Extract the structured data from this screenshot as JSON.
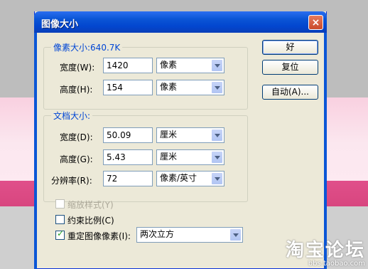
{
  "dialog": {
    "title": "图像大小",
    "close_glyph": "×"
  },
  "pixel_dimensions": {
    "legend": "像素大小:640.7K",
    "width": {
      "label": "宽度(W):",
      "value": "1420",
      "unit": "像素"
    },
    "height": {
      "label": "高度(H):",
      "value": "154",
      "unit": "像素"
    }
  },
  "document_size": {
    "legend": "文档大小:",
    "width": {
      "label": "宽度(D):",
      "value": "50.09",
      "unit": "厘米"
    },
    "height": {
      "label": "高度(G):",
      "value": "5.43",
      "unit": "厘米"
    },
    "resolution": {
      "label": "分辨率(R):",
      "value": "72",
      "unit": "像素/英寸"
    }
  },
  "options": {
    "scale_styles": {
      "label": "缩放样式(Y)",
      "checked": false,
      "enabled": false
    },
    "constrain_proportions": {
      "label": "约束比例(C)",
      "checked": false
    },
    "resample": {
      "label": "重定图像像素(I):",
      "checked": true,
      "method": "两次立方"
    }
  },
  "buttons": {
    "ok": "好",
    "reset": "复位",
    "auto": "自动(A)..."
  },
  "watermark": {
    "logo": "淘宝论坛",
    "url": "bbs.taobao.com"
  }
}
